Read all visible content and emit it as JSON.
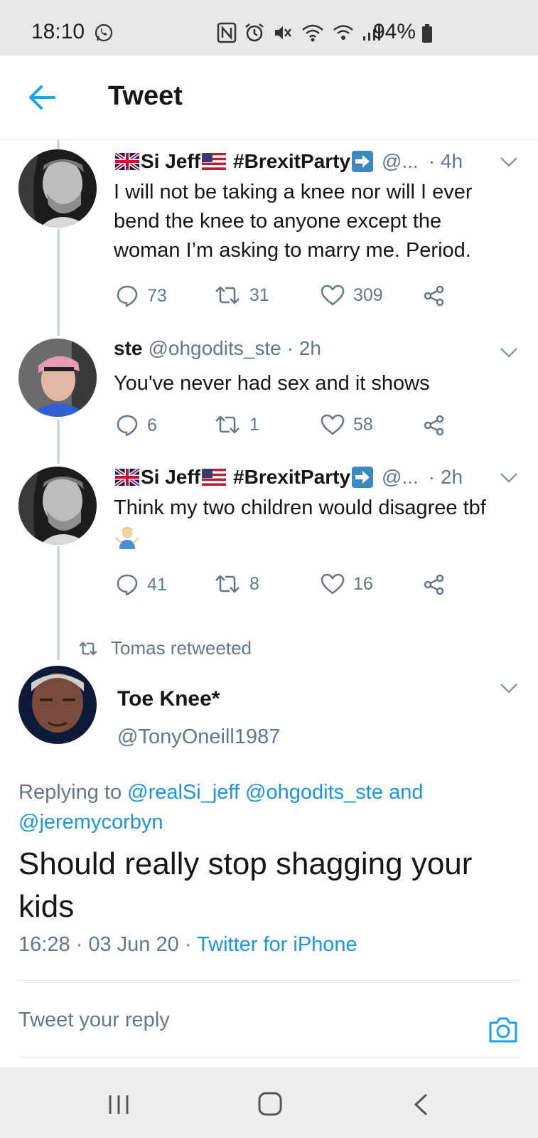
{
  "status_bar": {
    "time": "18:10",
    "battery": "94%",
    "icons": [
      "whatsapp-icon",
      "nfc-icon",
      "alarm-icon",
      "mute-icon",
      "wifi-icon",
      "call-signal-icon",
      "signal-bars-icon",
      "battery-icon"
    ]
  },
  "header": {
    "title": "Tweet"
  },
  "thread": [
    {
      "name": "Si Jeff",
      "hashtag": "#BrexitParty",
      "handle": "@...",
      "time": "· 4h",
      "text": "I will not be taking a knee nor will I ever bend the knee to anyone except the woman I’m asking to marry me. Period.",
      "replies": "73",
      "retweets": "31",
      "likes": "309"
    },
    {
      "name": "ste",
      "handle": "@ohgodits_ste",
      "time": "· 2h",
      "text": "You've never had sex and it shows",
      "replies": "6",
      "retweets": "1",
      "likes": "58"
    },
    {
      "name": "Si Jeff",
      "hashtag": "#BrexitParty",
      "handle": "@...",
      "time": "· 2h",
      "text": "Think my two children would disagree tbf",
      "replies": "41",
      "retweets": "8",
      "likes": "16"
    }
  ],
  "retweet_label": "Tomas retweeted",
  "main_tweet": {
    "name": "Toe Knee*",
    "handle": "@TonyOneill1987",
    "replying_prefix": "Replying to",
    "replying_to": [
      "@realSi_jeff",
      "@ohgodits_ste",
      "@jeremycorbyn"
    ],
    "replying_and": "and",
    "text": "Should really stop shagging your kids",
    "time": "16:28",
    "date": "03 Jun 20",
    "source": "Twitter for iPhone"
  },
  "reply_box": {
    "placeholder": "Tweet your reply"
  },
  "colors": {
    "accent": "#1da1f2",
    "link": "#1b95e0",
    "muted": "#657786",
    "text": "#14171a"
  }
}
